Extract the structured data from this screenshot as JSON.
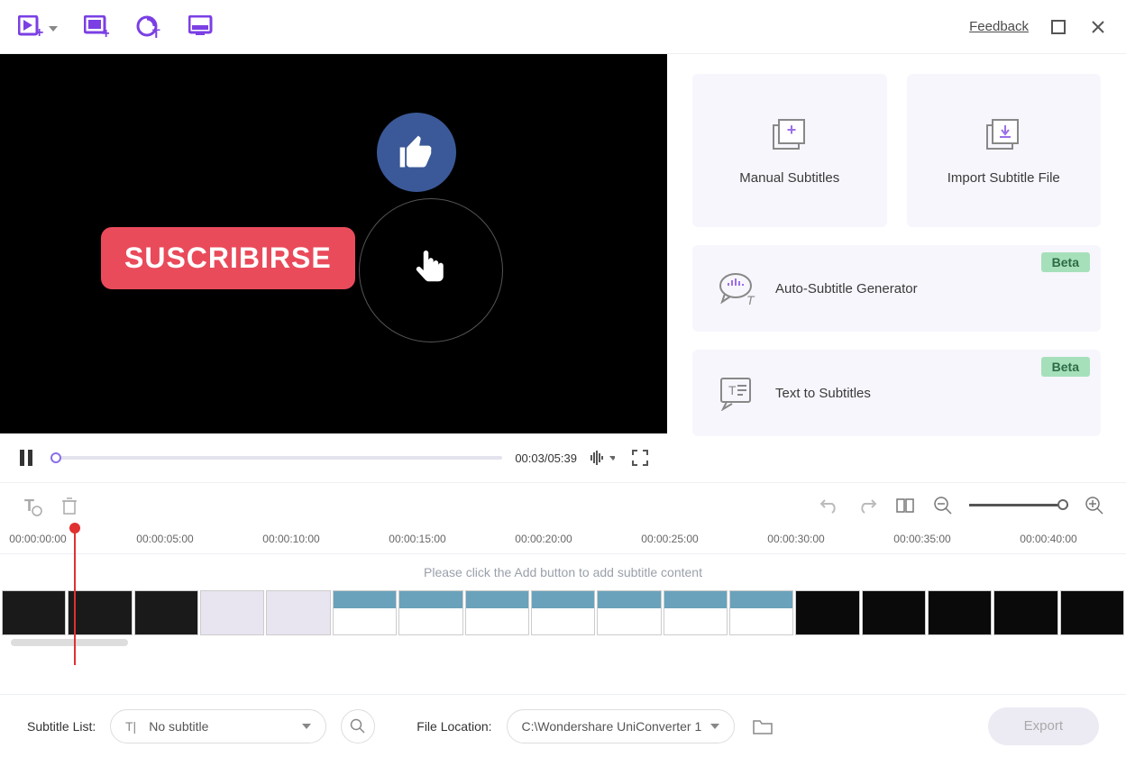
{
  "header": {
    "feedback": "Feedback"
  },
  "preview": {
    "subscribe_text": "SUSCRIBIRSE",
    "time": "00:03/05:39"
  },
  "side": {
    "manual_subtitles": "Manual Subtitles",
    "import_subtitle_file": "Import Subtitle File",
    "auto_subtitle_generator": "Auto-Subtitle Generator",
    "text_to_subtitles": "Text to Subtitles",
    "beta": "Beta"
  },
  "timeline": {
    "ticks": [
      "00:00:00:00",
      "00:00:05:00",
      "00:00:10:00",
      "00:00:15:00",
      "00:00:20:00",
      "00:00:25:00",
      "00:00:30:00",
      "00:00:35:00",
      "00:00:40:00"
    ],
    "placeholder": "Please click the Add button to add subtitle content"
  },
  "bottom": {
    "subtitle_list_label": "Subtitle List:",
    "subtitle_value": "No subtitle",
    "file_location_label": "File Location:",
    "file_location_value": "C:\\Wondershare UniConverter 1",
    "export": "Export"
  }
}
